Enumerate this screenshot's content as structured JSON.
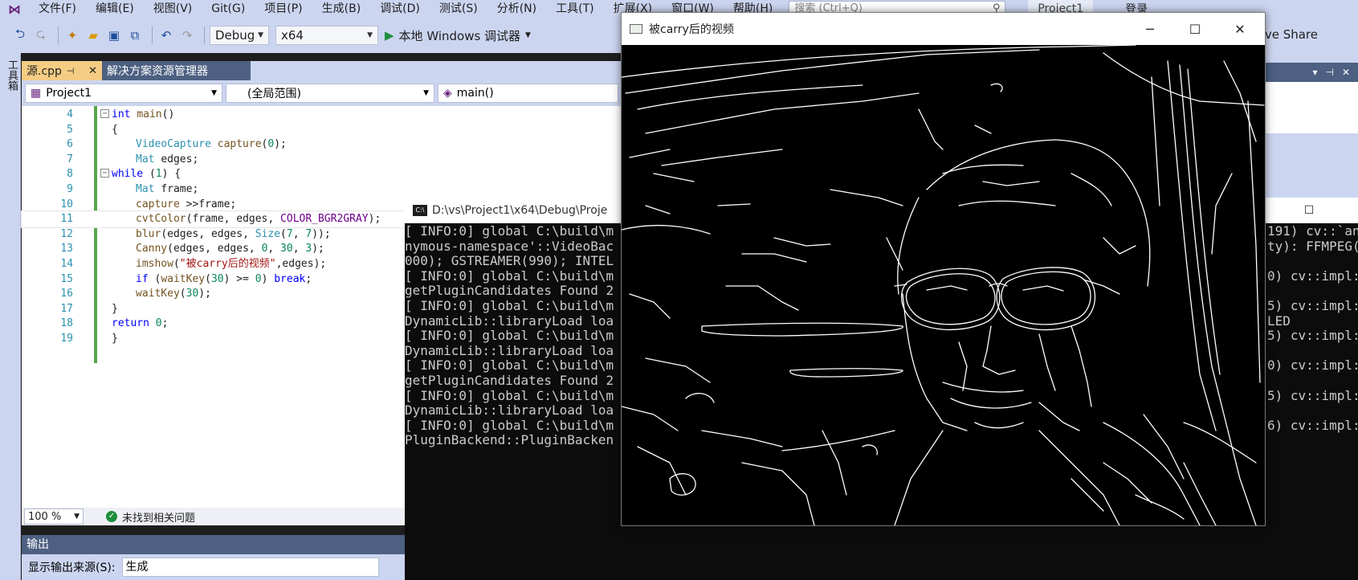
{
  "menu": {
    "items": [
      "文件(F)",
      "编辑(E)",
      "视图(V)",
      "Git(G)",
      "项目(P)",
      "生成(B)",
      "调试(D)",
      "测试(S)",
      "分析(N)",
      "工具(T)",
      "扩展(X)",
      "窗口(W)",
      "帮助(H)"
    ],
    "search_placeholder": "搜索 (Ctrl+Q)",
    "project_title": "Project1",
    "login": "登录"
  },
  "toolbar": {
    "config": "Debug",
    "platform": "x64",
    "run_label": "本地 Windows 调试器",
    "live_share": "Live Share"
  },
  "toolbox_label": "工具箱",
  "tabs": [
    {
      "label": "源.cpp",
      "active": true
    },
    {
      "label": "解决方案资源管理器",
      "active": false
    }
  ],
  "navbar": {
    "project": "Project1",
    "scope": "(全局范围)",
    "member": "main()"
  },
  "code": {
    "lines": [
      {
        "n": "4",
        "text": "int main()"
      },
      {
        "n": "5",
        "text": "{"
      },
      {
        "n": "6",
        "text": "VideoCapture capture(0);"
      },
      {
        "n": "7",
        "text": "Mat edges;"
      },
      {
        "n": "8",
        "text": "while (1) {"
      },
      {
        "n": "9",
        "text": "Mat frame;"
      },
      {
        "n": "10",
        "text": "capture >>frame;"
      },
      {
        "n": "11",
        "text": "cvtColor(frame, edges, COLOR_BGR2GRAY);"
      },
      {
        "n": "12",
        "text": "blur(edges, edges, Size(7, 7));"
      },
      {
        "n": "13",
        "text": "Canny(edges, edges, 0, 30, 3);"
      },
      {
        "n": "14",
        "text": "imshow(\"被carry后的视频\",edges);"
      },
      {
        "n": "15",
        "text": "if (waitKey(30) >= 0) break;"
      },
      {
        "n": "16",
        "text": "waitKey(30);"
      },
      {
        "n": "17",
        "text": "}"
      },
      {
        "n": "18",
        "text": "return 0;"
      },
      {
        "n": "19",
        "text": "}"
      }
    ]
  },
  "editor_status": {
    "zoom": "100 %",
    "issues": "未找到相关问题"
  },
  "output": {
    "title": "输出",
    "source_label": "显示输出来源(S):",
    "source_value": "生成"
  },
  "console": {
    "title": "D:\\vs\\Project1\\x64\\Debug\\Proje",
    "lines_left": [
      "[ INFO:0] global C:\\build\\m",
      "nymous-namespace'::VideoBac",
      "000); GSTREAMER(990); INTEL",
      "[ INFO:0] global C:\\build\\m",
      "getPluginCandidates Found 2",
      "[ INFO:0] global C:\\build\\m",
      "DynamicLib::libraryLoad loa",
      "[ INFO:0] global C:\\build\\m",
      "DynamicLib::libraryLoad loa",
      "[ INFO:0] global C:\\build\\m",
      "getPluginCandidates Found 2",
      "[ INFO:0] global C:\\build\\m",
      "DynamicLib::libraryLoad loa",
      "[ INFO:0] global C:\\build\\m",
      "PluginBackend::PluginBacken"
    ],
    "lines_right": [
      "191) cv::`an",
      "ty): FFMPEG(",
      "",
      "0) cv::impl:",
      "",
      "5) cv::impl:",
      "LED",
      "5) cv::impl:",
      "",
      "0) cv::impl:",
      "",
      "5) cv::impl:",
      "",
      "6) cv::impl:",
      ""
    ]
  },
  "image_window": {
    "title": "被carry后的视频"
  }
}
